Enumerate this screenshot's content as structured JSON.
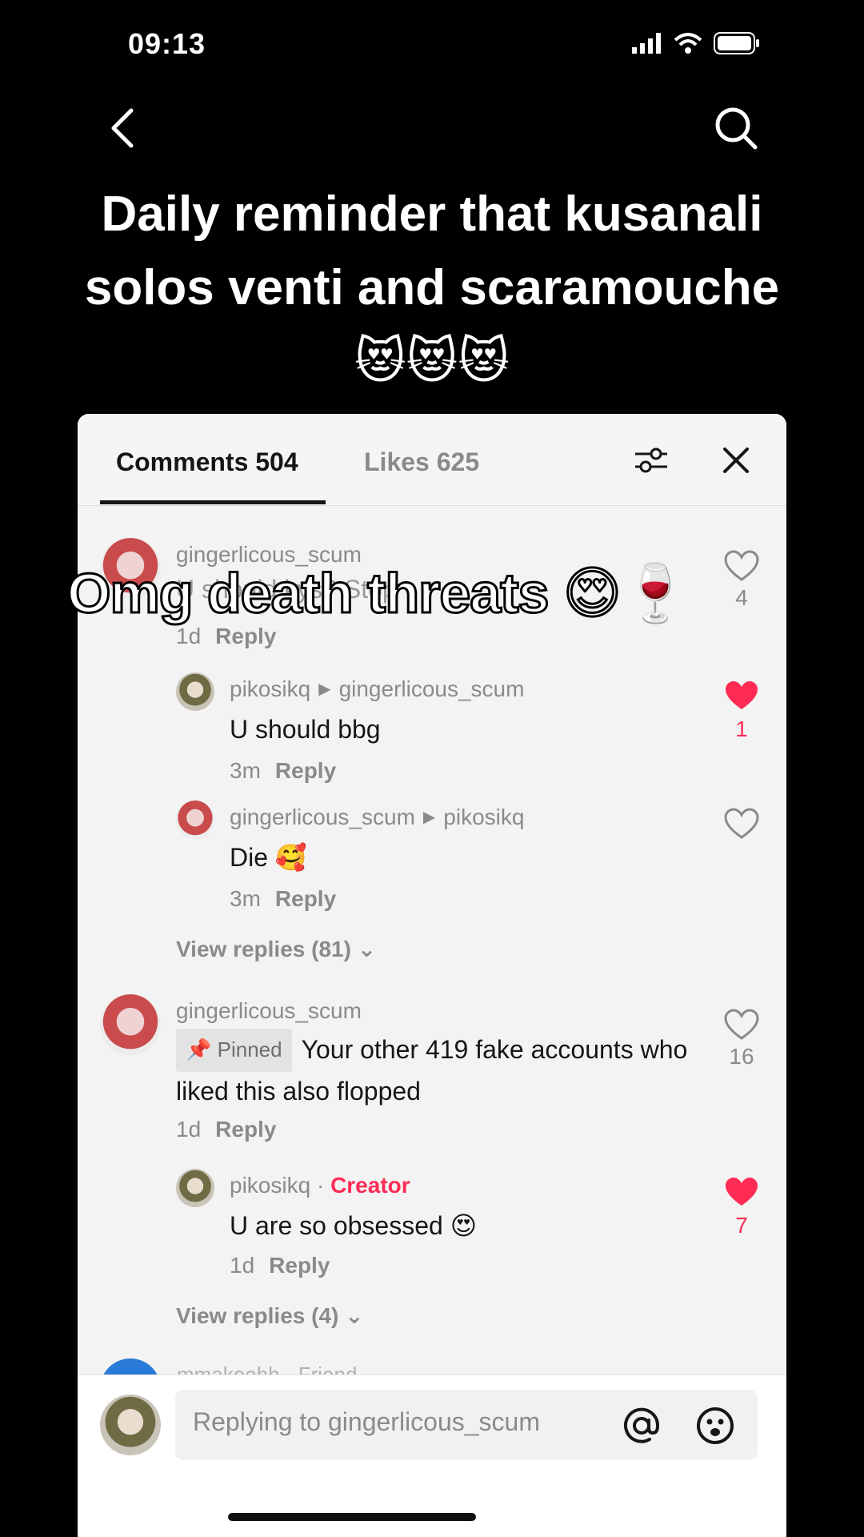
{
  "status": {
    "time": "09:13"
  },
  "headline": "Daily reminder that kusanali solos venti and scaramouche 😻😻😻",
  "overlay_caption": "Omg death threats 😍🍷",
  "tabs": {
    "comments": "Comments 504",
    "likes": "Likes 625"
  },
  "comments": [
    {
      "user": "gingerlicous_scum",
      "text": "U should kys? Stop",
      "meta_time": "1d",
      "reply_label": "Reply",
      "likes": "4"
    },
    {
      "user": "pikosikq",
      "reply_to": "gingerlicous_scum",
      "text": "U should bbg",
      "meta_time": "3m",
      "reply_label": "Reply",
      "likes": "1"
    },
    {
      "user": "gingerlicous_scum",
      "reply_to": "pikosikq",
      "text": "Die 🥰",
      "meta_time": "3m",
      "reply_label": "Reply"
    },
    {
      "view_replies": "View replies (81)"
    },
    {
      "user": "gingerlicous_scum",
      "pinned_label": "Pinned",
      "text": "Your other 419 fake accounts who liked this also flopped",
      "meta_time": "1d",
      "reply_label": "Reply",
      "likes": "16"
    },
    {
      "user": "pikosikq",
      "creator_label": "Creator",
      "text": "U are so obsessed 😍",
      "meta_time": "1d",
      "reply_label": "Reply",
      "likes": "7"
    },
    {
      "view_replies": "View replies (4)"
    }
  ],
  "cutoff_user": "mmakoohh · Friend",
  "input": {
    "placeholder": "Replying to gingerlicous_scum"
  },
  "colors": {
    "accent": "#fe2c55",
    "panel_bg": "#f3f3f3"
  }
}
